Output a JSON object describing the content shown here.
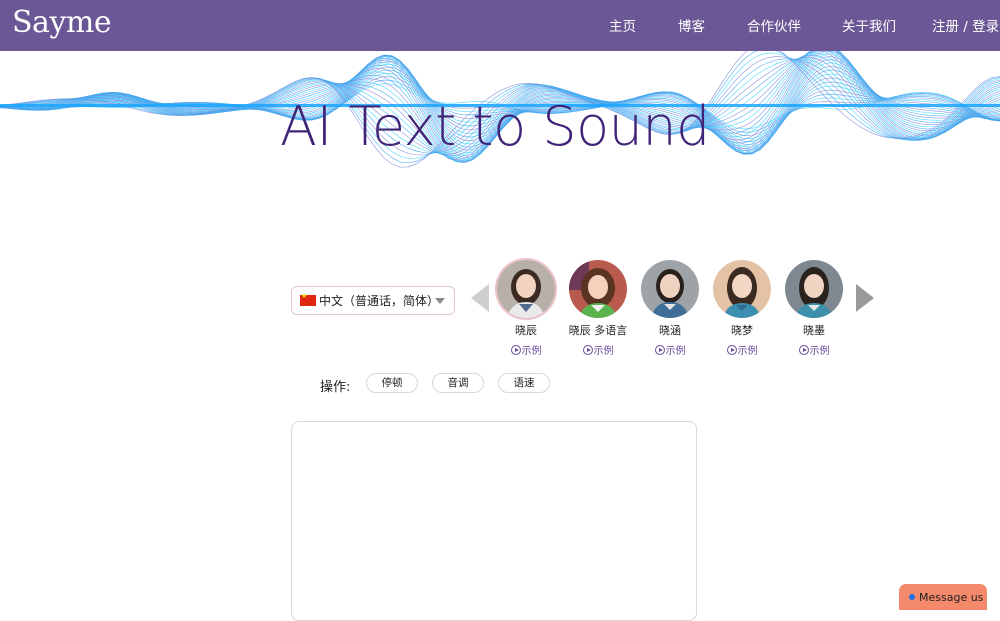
{
  "brand": {
    "logo": "Sayme",
    "color": "#6b5795",
    "title_color": "#3f2477"
  },
  "nav": {
    "home": "主页",
    "blog": "博客",
    "partners": "合作伙伴",
    "about": "关于我们",
    "auth": "注册 / 登录"
  },
  "hero": {
    "title": "AI Text to Sound"
  },
  "language": {
    "selected": "中文（普通话，简体）",
    "flag": "cn-flag-icon"
  },
  "voices": [
    {
      "name": "晓辰",
      "sample": "示例",
      "selected": true
    },
    {
      "name": "晓辰 多语言",
      "sample": "示例",
      "selected": false
    },
    {
      "name": "晓涵",
      "sample": "示例",
      "selected": false
    },
    {
      "name": "晓梦",
      "sample": "示例",
      "selected": false
    },
    {
      "name": "晓墨",
      "sample": "示例",
      "selected": false
    }
  ],
  "operations": {
    "label": "操作:",
    "pause": "停顿",
    "pitch": "音调",
    "speed": "语速"
  },
  "text_input": {
    "value": "",
    "placeholder": ""
  },
  "message": {
    "label": "Message us",
    "dot_color": "#1e6fe8",
    "bg_color": "#f4896b"
  }
}
